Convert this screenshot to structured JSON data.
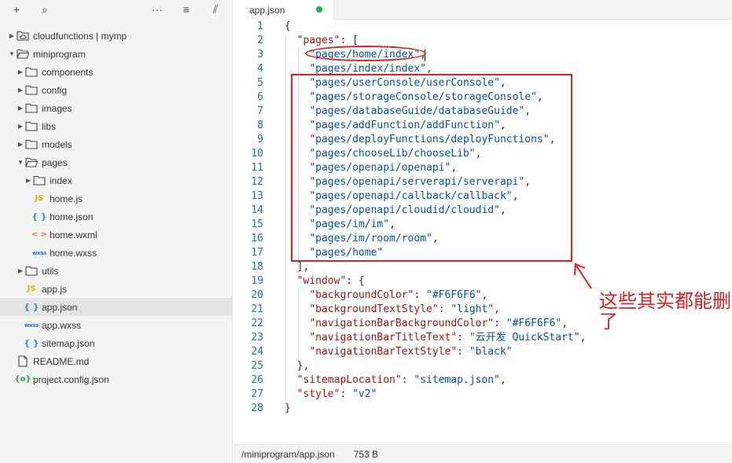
{
  "toolbar": {
    "icons": [
      "plus-icon",
      "search-icon",
      "more-icon",
      "collapse-icon",
      "split-icon"
    ],
    "glyphs": [
      "+",
      "⌕",
      "···",
      "≡",
      "⫽"
    ]
  },
  "tree": [
    {
      "label": "cloudfunctions | mymp",
      "type": "folder-cloud",
      "depth": 0,
      "arrow": "right"
    },
    {
      "label": "miniprogram",
      "type": "folder-open",
      "depth": 0,
      "arrow": "down"
    },
    {
      "label": "components",
      "type": "folder",
      "depth": 1,
      "arrow": "right"
    },
    {
      "label": "config",
      "type": "folder",
      "depth": 1,
      "arrow": "right"
    },
    {
      "label": "images",
      "type": "folder",
      "depth": 1,
      "arrow": "right"
    },
    {
      "label": "libs",
      "type": "folder",
      "depth": 1,
      "arrow": "right"
    },
    {
      "label": "models",
      "type": "folder",
      "depth": 1,
      "arrow": "right"
    },
    {
      "label": "pages",
      "type": "folder-open",
      "depth": 1,
      "arrow": "down"
    },
    {
      "label": "index",
      "type": "folder",
      "depth": 2,
      "arrow": "right"
    },
    {
      "label": "home.js",
      "type": "js",
      "depth": 2,
      "arrow": ""
    },
    {
      "label": "home.json",
      "type": "json",
      "depth": 2,
      "arrow": ""
    },
    {
      "label": "home.wxml",
      "type": "wxml",
      "depth": 2,
      "arrow": ""
    },
    {
      "label": "home.wxss",
      "type": "wxss",
      "depth": 2,
      "arrow": ""
    },
    {
      "label": "utils",
      "type": "folder",
      "depth": 1,
      "arrow": "right"
    },
    {
      "label": "app.js",
      "type": "js",
      "depth": 1,
      "arrow": ""
    },
    {
      "label": "app.json",
      "type": "json",
      "depth": 1,
      "arrow": "",
      "selected": true
    },
    {
      "label": "app.wxss",
      "type": "wxss",
      "depth": 1,
      "arrow": ""
    },
    {
      "label": "sitemap.json",
      "type": "json",
      "depth": 1,
      "arrow": ""
    },
    {
      "label": "README.md",
      "type": "doc",
      "depth": 0,
      "arrow": ""
    },
    {
      "label": "project.config.json",
      "type": "config",
      "depth": 0,
      "arrow": ""
    }
  ],
  "icon_glyphs": {
    "js": "JS",
    "json": "{ }",
    "wxml": "< >",
    "wxss": "wxss",
    "config": "{o}"
  },
  "tab": {
    "label": "app.json",
    "modified": true
  },
  "code": [
    [
      [
        "p",
        "{"
      ]
    ],
    [
      [
        "p",
        "  "
      ],
      [
        "k",
        "\"pages\""
      ],
      [
        "p",
        ": ["
      ]
    ],
    [
      [
        "p",
        "    "
      ],
      [
        "s",
        "\"pages/home/index\""
      ],
      [
        "p",
        ","
      ]
    ],
    [
      [
        "p",
        "    "
      ],
      [
        "s",
        "\"pages/index/index\""
      ],
      [
        "p",
        ","
      ]
    ],
    [
      [
        "p",
        "    "
      ],
      [
        "s",
        "\"pages/userConsole/userConsole\""
      ],
      [
        "p",
        ","
      ]
    ],
    [
      [
        "p",
        "    "
      ],
      [
        "s",
        "\"pages/storageConsole/storageConsole\""
      ],
      [
        "p",
        ","
      ]
    ],
    [
      [
        "p",
        "    "
      ],
      [
        "s",
        "\"pages/databaseGuide/databaseGuide\""
      ],
      [
        "p",
        ","
      ]
    ],
    [
      [
        "p",
        "    "
      ],
      [
        "s",
        "\"pages/addFunction/addFunction\""
      ],
      [
        "p",
        ","
      ]
    ],
    [
      [
        "p",
        "    "
      ],
      [
        "s",
        "\"pages/deployFunctions/deployFunctions\""
      ],
      [
        "p",
        ","
      ]
    ],
    [
      [
        "p",
        "    "
      ],
      [
        "s",
        "\"pages/chooseLib/chooseLib\""
      ],
      [
        "p",
        ","
      ]
    ],
    [
      [
        "p",
        "    "
      ],
      [
        "s",
        "\"pages/openapi/openapi\""
      ],
      [
        "p",
        ","
      ]
    ],
    [
      [
        "p",
        "    "
      ],
      [
        "s",
        "\"pages/openapi/serverapi/serverapi\""
      ],
      [
        "p",
        ","
      ]
    ],
    [
      [
        "p",
        "    "
      ],
      [
        "s",
        "\"pages/openapi/callback/callback\""
      ],
      [
        "p",
        ","
      ]
    ],
    [
      [
        "p",
        "    "
      ],
      [
        "s",
        "\"pages/openapi/cloudid/cloudid\""
      ],
      [
        "p",
        ","
      ]
    ],
    [
      [
        "p",
        "    "
      ],
      [
        "s",
        "\"pages/im/im\""
      ],
      [
        "p",
        ","
      ]
    ],
    [
      [
        "p",
        "    "
      ],
      [
        "s",
        "\"pages/im/room/room\""
      ],
      [
        "p",
        ","
      ]
    ],
    [
      [
        "p",
        "    "
      ],
      [
        "s",
        "\"pages/home\""
      ]
    ],
    [
      [
        "p",
        "  ],"
      ]
    ],
    [
      [
        "p",
        "  "
      ],
      [
        "k",
        "\"window\""
      ],
      [
        "p",
        ": {"
      ]
    ],
    [
      [
        "p",
        "    "
      ],
      [
        "k",
        "\"backgroundColor\""
      ],
      [
        "p",
        ": "
      ],
      [
        "s",
        "\"#F6F6F6\""
      ],
      [
        "p",
        ","
      ]
    ],
    [
      [
        "p",
        "    "
      ],
      [
        "k",
        "\"backgroundTextStyle\""
      ],
      [
        "p",
        ": "
      ],
      [
        "s",
        "\"light\""
      ],
      [
        "p",
        ","
      ]
    ],
    [
      [
        "p",
        "    "
      ],
      [
        "k",
        "\"navigationBarBackgroundColor\""
      ],
      [
        "p",
        ": "
      ],
      [
        "s",
        "\"#F6F6F6\""
      ],
      [
        "p",
        ","
      ]
    ],
    [
      [
        "p",
        "    "
      ],
      [
        "k",
        "\"navigationBarTitleText\""
      ],
      [
        "p",
        ": "
      ],
      [
        "s",
        "\"云开发 QuickStart\""
      ],
      [
        "p",
        ","
      ]
    ],
    [
      [
        "p",
        "    "
      ],
      [
        "k",
        "\"navigationBarTextStyle\""
      ],
      [
        "p",
        ": "
      ],
      [
        "s",
        "\"black\""
      ]
    ],
    [
      [
        "p",
        "  },"
      ]
    ],
    [
      [
        "p",
        "  "
      ],
      [
        "k",
        "\"sitemapLocation\""
      ],
      [
        "p",
        ": "
      ],
      [
        "s",
        "\"sitemap.json\""
      ],
      [
        "p",
        ","
      ]
    ],
    [
      [
        "p",
        "  "
      ],
      [
        "k",
        "\"style\""
      ],
      [
        "p",
        ": "
      ],
      [
        "s",
        "\"v2\""
      ]
    ],
    [
      [
        "p",
        "}"
      ]
    ]
  ],
  "status": {
    "path": "/miniprogram/app.json",
    "size": "753 B"
  },
  "annotation": {
    "text": "这些其实都能删了",
    "color": "#e02020"
  },
  "colors": {
    "key": "#a31515",
    "string": "#0451a5",
    "line_number": "#237893",
    "modified_dot": "#27ae60",
    "selection": "#e4e4e4"
  }
}
